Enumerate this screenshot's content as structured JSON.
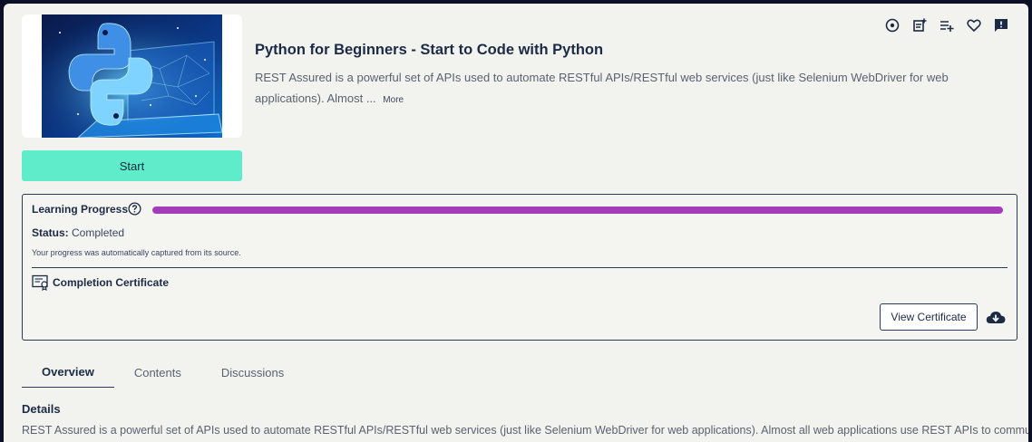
{
  "course": {
    "title": "Python for Beginners - Start to Code with Python",
    "description": "REST Assured is a powerful set of APIs used to automate RESTful APIs/RESTful web services (just like Selenium WebDriver for web applications). Almost ...",
    "more_label": "More",
    "start_label": "Start"
  },
  "actions": {
    "icons": [
      "target-icon",
      "add-note-icon",
      "add-to-playlist-icon",
      "heart-icon",
      "feedback-icon"
    ]
  },
  "progress": {
    "label": "Learning Progress",
    "value": 1.0,
    "bar_color": "#a33cb9",
    "status_label": "Status:",
    "status_value": "Completed",
    "note": "Your progress was automatically captured from its source."
  },
  "certificate": {
    "label": "Completion Certificate",
    "view_label": "View Certificate"
  },
  "tabs": [
    {
      "label": "Overview",
      "active": true
    },
    {
      "label": "Contents",
      "active": false
    },
    {
      "label": "Discussions",
      "active": false
    }
  ],
  "details": {
    "heading": "Details",
    "text": "REST Assured is a powerful set of APIs used to automate RESTful APIs/RESTful web services (just like Selenium WebDriver for web applications). Almost all web applications use REST APIs to communicate with"
  },
  "colors": {
    "accent_start": "#5eeccb",
    "text_dark": "#1c2b45",
    "background": "#f2f2ef"
  }
}
